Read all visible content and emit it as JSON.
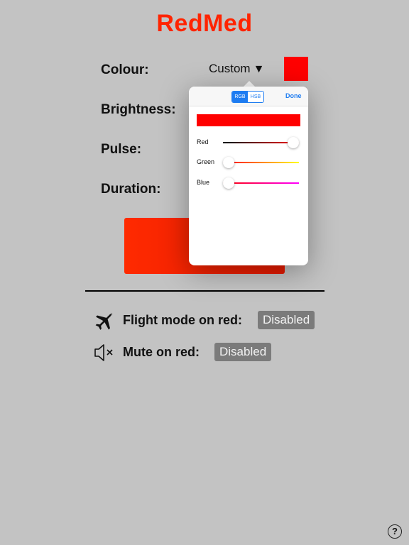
{
  "app": {
    "title": "RedMed"
  },
  "colors": {
    "accent": "#ff2400",
    "selected": "#ff0000",
    "badge": "#7b7b7b",
    "ios_blue": "#1e7cf1"
  },
  "settings": {
    "colour": {
      "label": "Colour:",
      "value": "Custom",
      "caret": "▼"
    },
    "brightness": {
      "label": "Brightness:"
    },
    "pulse": {
      "label": "Pulse:"
    },
    "duration": {
      "label": "Duration:"
    }
  },
  "options": {
    "flight_mode": {
      "label": "Flight mode on red:",
      "value": "Disabled",
      "icon": "airplane-icon"
    },
    "mute": {
      "label": "Mute on red:",
      "value": "Disabled",
      "icon": "speaker-mute-icon"
    }
  },
  "color_picker": {
    "tabs": [
      "RGB",
      "HSB"
    ],
    "selected_tab": "RGB",
    "done_label": "Done",
    "sliders": [
      {
        "label": "Red",
        "value": 1.0
      },
      {
        "label": "Green",
        "value": 0.0
      },
      {
        "label": "Blue",
        "value": 0.0
      }
    ]
  },
  "help": {
    "label": "?"
  }
}
